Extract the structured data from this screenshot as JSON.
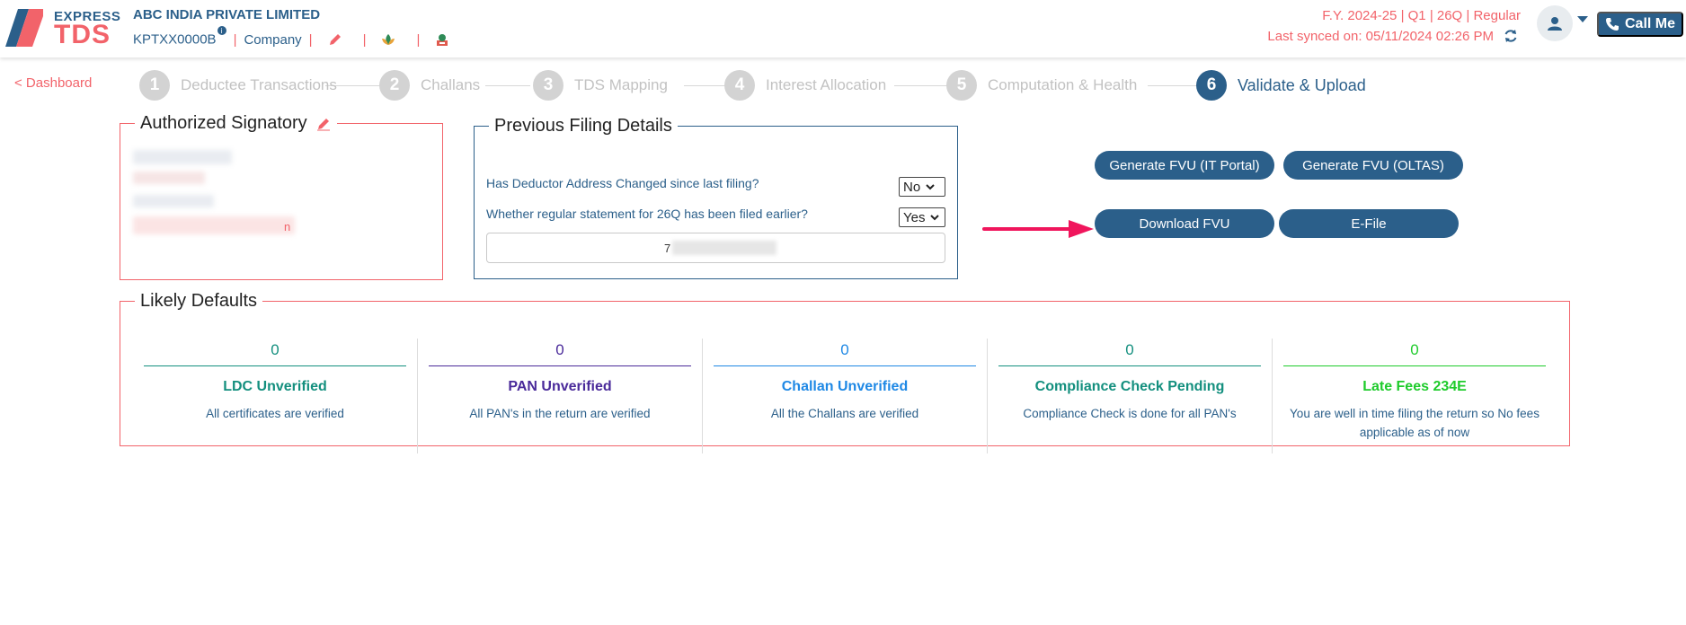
{
  "header": {
    "logo_express": "EXPRESS",
    "logo_tds": "TDS",
    "company_name": "ABC INDIA PRIVATE LIMITED",
    "tan": "KPTXX0000B",
    "entity_type": "Company",
    "fy_line": "F.Y. 2024-25  | Q1  | 26Q | Regular",
    "last_synced": "Last synced on: 05/11/2024 02:26 PM",
    "call_me": "Call Me"
  },
  "nav": {
    "back_link": "< Dashboard",
    "steps": [
      {
        "num": "1",
        "label": "Deductee Transactions"
      },
      {
        "num": "2",
        "label": "Challans"
      },
      {
        "num": "3",
        "label": "TDS Mapping"
      },
      {
        "num": "4",
        "label": "Interest Allocation"
      },
      {
        "num": "5",
        "label": "Computation & Health"
      },
      {
        "num": "6",
        "label": "Validate & Upload"
      }
    ]
  },
  "authorized": {
    "title": "Authorized Signatory",
    "visible_tail": "n"
  },
  "previous": {
    "title": "Previous Filing Details",
    "q_address": "Has Deductor Address Changed since last filing?",
    "a_address": "No",
    "q_regular": "Whether regular statement for 26Q has been filed earlier?",
    "a_regular": "Yes",
    "receipt_prefix": "7"
  },
  "actions": {
    "gen_it_portal": "Generate FVU (IT Portal)",
    "gen_oltas": "Generate FVU (OLTAS)",
    "download_fvu": "Download FVU",
    "efile": "E-File"
  },
  "likely": {
    "title": "Likely Defaults",
    "items": [
      {
        "count": "0",
        "title": "LDC Unverified",
        "desc": "All certificates are verified",
        "color": "#138f7e"
      },
      {
        "count": "0",
        "title": "PAN Unverified",
        "desc": "All PAN's in the return are verified",
        "color": "#4a2a9a"
      },
      {
        "count": "0",
        "title": "Challan Unverified",
        "desc": "All the Challans are verified",
        "color": "#1e88e5"
      },
      {
        "count": "0",
        "title": "Compliance Check Pending",
        "desc": "Compliance Check is done for all PAN's",
        "color": "#138f7e"
      },
      {
        "count": "0",
        "title": "Late Fees 234E",
        "desc": "You are well in time filing the return so No fees applicable as of now",
        "color": "#1ecb2b"
      }
    ]
  }
}
